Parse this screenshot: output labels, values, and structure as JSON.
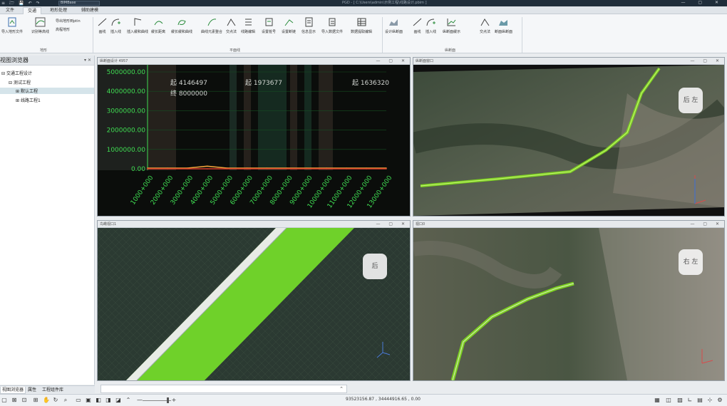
{
  "titlebar": {
    "quick_access": "≡ 🗁 💾 ↶ ↷",
    "profile": "BIMBase",
    "title": "PGD - [ C:\\Users\\admin\\示例工程\\线路设计.pbim ]",
    "window_controls": "— ▢ ✕"
  },
  "menu": {
    "tabs": [
      "文件",
      "交通",
      "地形处理",
      "辅助建模"
    ],
    "active": "交通"
  },
  "ribbon": {
    "buttons": [
      {
        "label": "导入地形文件",
        "icon": "import-terrain-icon"
      },
      {
        "label": "识别等高线",
        "icon": "contour-icon"
      },
      {
        "label": "导出地形到ptin",
        "icon": "export-icon"
      },
      {
        "label": "高程地形",
        "icon": "terrain-icon"
      },
      {
        "label": "画线",
        "icon": "line-icon"
      },
      {
        "label": "插入线",
        "icon": "insert-line-icon"
      },
      {
        "label": "插入缓和曲线",
        "icon": "spiral-icon"
      },
      {
        "label": "缓长距离",
        "icon": "length-icon"
      },
      {
        "label": "缓长缓和曲线",
        "icon": "curve-icon"
      },
      {
        "label": "曲线元素整合",
        "icon": "merge-icon"
      },
      {
        "label": "交点法",
        "icon": "intersection-icon"
      },
      {
        "label": "线路编辑",
        "icon": "edit-route-icon"
      },
      {
        "label": "设置桩号",
        "icon": "station-icon"
      },
      {
        "label": "设置断链",
        "icon": "chain-icon"
      },
      {
        "label": "信息显示",
        "icon": "info-icon"
      },
      {
        "label": "导入数据文件",
        "icon": "import-data-icon"
      },
      {
        "label": "数据提取编辑",
        "icon": "table-icon"
      },
      {
        "label": "设计纵断面",
        "icon": "profile-icon"
      },
      {
        "label": "画线",
        "icon": "line-icon"
      },
      {
        "label": "插入线",
        "icon": "insert-line-icon"
      },
      {
        "label": "纵断面缓示",
        "icon": "chart-icon"
      },
      {
        "label": "交点法",
        "icon": "intersection-icon"
      },
      {
        "label": "断面纵断面",
        "icon": "section-icon"
      }
    ],
    "groups": [
      "地形",
      "平面线",
      "纵断面"
    ]
  },
  "left_panel": {
    "title": "视图浏览器",
    "pin": "▾ ✕",
    "tree": [
      {
        "label": "交通工程设计",
        "toggle": "⊟"
      },
      {
        "label": "测试工程",
        "toggle": "⊟"
      },
      {
        "label": "默认工程",
        "toggle": "⊞"
      },
      {
        "label": "线路工程1",
        "toggle": "⊞"
      }
    ],
    "bottom_tabs": [
      "视图浏览器",
      "属性",
      "工程组件库"
    ]
  },
  "viewports": [
    {
      "title": "纵断面设计 4957"
    },
    {
      "title": "纵断面窗口"
    },
    {
      "title": "鸟瞰视口1"
    },
    {
      "title": "视口0"
    }
  ],
  "viewport_controls": "— ▢ ✕",
  "compass": [
    "后 左",
    "后",
    "右 左"
  ],
  "profile_info": {
    "labels": [
      "起 4146497",
      "终 8000000",
      "起 1973677",
      "起 1636320"
    ]
  },
  "chart_data": {
    "type": "line",
    "y_ticks": [
      "5000000.00",
      "4000000.00",
      "3000000.00",
      "2000000.00",
      "1000000.00",
      "0.00"
    ],
    "x_ticks": [
      "1000+000",
      "2000+000",
      "3000+000",
      "4000+000",
      "5000+000",
      "6000+000",
      "7000+000",
      "8000+000",
      "9000+000",
      "10000+000",
      "11000+000",
      "12000+000",
      "13000+000"
    ],
    "ylim": [
      0,
      5000000
    ],
    "series": [
      {
        "values": [
          0,
          0,
          0,
          100000,
          0,
          0,
          0,
          0,
          0,
          0,
          0,
          0,
          0
        ],
        "color": "#f2a33a"
      },
      {
        "values": [
          0,
          0,
          0,
          0,
          0,
          0,
          0,
          0,
          0,
          0,
          0,
          0,
          0
        ],
        "color": "#d83b2b"
      }
    ],
    "grid": true
  },
  "command_line": {
    "chevron": "⌃"
  },
  "status": {
    "coords": "93523156.87 , 34444916.65 , 0.00",
    "zoom_minus": "—",
    "zoom_plus": "+"
  },
  "colors": {
    "accent": "#2f8c46",
    "chart_bg": "#0a0f0a",
    "grid": "#1e6b2c",
    "route_green": "#7ed321"
  }
}
